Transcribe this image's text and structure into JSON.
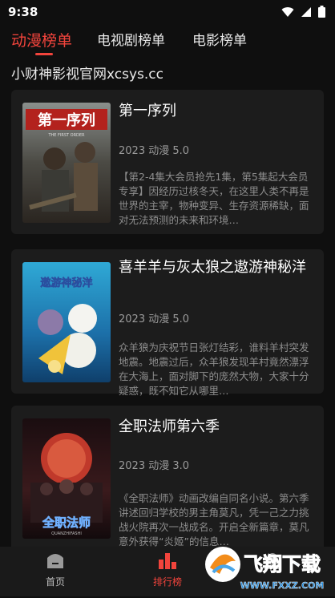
{
  "status_bar": {
    "time": "9:38"
  },
  "tabs": [
    {
      "label": "动漫榜单",
      "active": true
    },
    {
      "label": "电视剧榜单",
      "active": false
    },
    {
      "label": "电影榜单",
      "active": false
    }
  ],
  "banner_text": "小财神影视官网xcsys.cc",
  "items": [
    {
      "title": "第一序列",
      "meta": "2023 动漫 5.0",
      "description": "【第2-4集大会员抢先1集，第5集起大会员专享】因经历过核冬天，在这里人类不再是世界的主宰，物种变异、生存资源稀缺，面对无法预测的未来和环境…",
      "poster_text": "第一序列",
      "poster_subtext": "THE FIRST ORDER"
    },
    {
      "title": "喜羊羊与灰太狼之遨游神秘洋",
      "meta": "2023 动漫 5.0",
      "description": "众羊狼为庆祝节日张灯结彩，谁料羊村突发地震。地震过后，众羊狼发现羊村竟然漂浮在大海上，面对脚下的庞然大物，大家十分疑惑，既不知它从哪里…",
      "poster_text": "遨游神秘洋"
    },
    {
      "title": "全职法师第六季",
      "meta": "2023 动漫 3.0",
      "description": "《全职法师》动画改编自同名小说。第六季讲述回归学校的男主角莫凡，凭一己之力挑战火院再次一战成名。开启全新篇章，莫凡意外获得“炎姬”的信息…",
      "poster_text": "全职法师",
      "poster_subtext": "QUANZHIFASHI"
    }
  ],
  "bottom_nav": [
    {
      "label": "首页",
      "icon": "home-icon"
    },
    {
      "label": "排行榜",
      "icon": "ranking-icon",
      "active": true
    },
    {
      "label": "",
      "icon": "profile-icon"
    }
  ],
  "overlay_watermark": {
    "text": "飞翔下载",
    "url": "WWW.FXXZ.COM"
  },
  "colors": {
    "accent": "#f2443c",
    "background": "#0f0f0f",
    "card": "#1c1c1c"
  }
}
